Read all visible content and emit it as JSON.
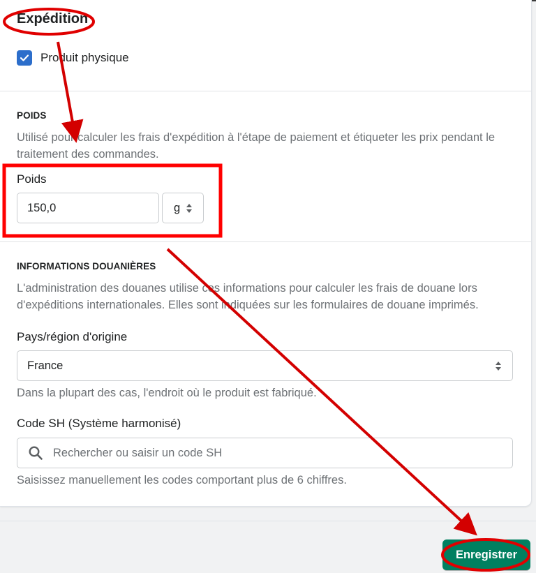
{
  "shipping": {
    "title": "Expédition",
    "physical_product_label": "Produit physique",
    "physical_product_checked": true
  },
  "weight": {
    "section_title": "POIDS",
    "help": "Utilisé pour calculer les frais d'expédition à l'étape de paiement et étiqueter les prix pendant le traitement des commandes.",
    "label": "Poids",
    "value": "150,0",
    "unit": "g"
  },
  "customs": {
    "section_title": "INFORMATIONS DOUANIÈRES",
    "help": "L'administration des douanes utilise ces informations pour calculer les frais de douane lors d'expéditions internationales. Elles sont indiquées sur les formulaires de douane imprimés.",
    "origin_label": "Pays/région d'origine",
    "origin_value": "France",
    "origin_help": "Dans la plupart des cas, l'endroit où le produit est fabriqué.",
    "hs_label": "Code SH (Système harmonisé)",
    "hs_placeholder": "Rechercher ou saisir un code SH",
    "hs_help": "Saisissez manuellement les codes comportant plus de 6 chiffres."
  },
  "footer": {
    "save_label": "Enregistrer"
  },
  "colors": {
    "primary_button": "#008060",
    "checkbox": "#2c6ecb",
    "annotation": "#e00000"
  },
  "icons": [
    "check-icon",
    "stepper-icon",
    "search-icon"
  ]
}
